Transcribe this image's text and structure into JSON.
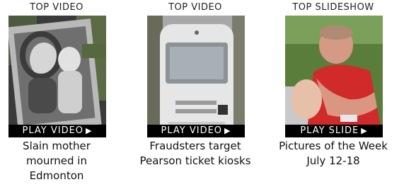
{
  "items": [
    {
      "section_label": "TOP VIDEO",
      "play_label": "PLAY VIDEO",
      "caption_lines": [
        "Slain mother",
        "mourned in",
        "Edmonton"
      ]
    },
    {
      "section_label": "TOP VIDEO",
      "play_label": "PLAY VIDEO",
      "caption_lines": [
        "Fraudsters target",
        "Pearson ticket kiosks"
      ]
    },
    {
      "section_label": "TOP SLIDESHOW",
      "play_label": "PLAY SLIDE",
      "caption_lines": [
        "Pictures of the Week",
        "July 12-18"
      ]
    }
  ],
  "colors": {
    "play_bar": "#000000",
    "play_text": "#ffffff"
  }
}
